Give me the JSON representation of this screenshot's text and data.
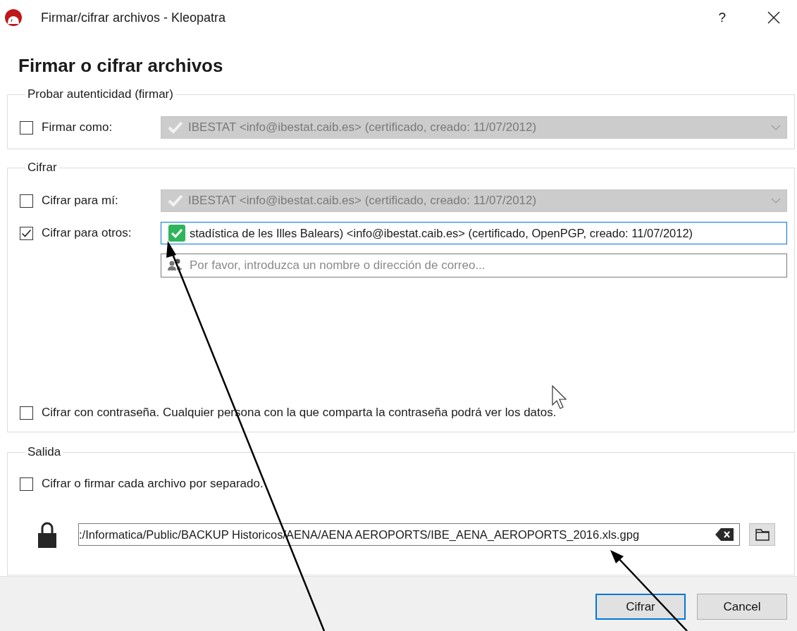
{
  "window": {
    "title": "Firmar/cifrar archivos - Kleopatra",
    "help": "?"
  },
  "heading": "Firmar o cifrar archivos",
  "sign": {
    "legend": "Probar autenticidad (firmar)",
    "sign_as": {
      "label": "Firmar como:",
      "checked": false,
      "value": "IBESTAT <info@ibestat.caib.es> (certificado,  creado: 11/07/2012)",
      "disabled": true
    }
  },
  "encrypt": {
    "legend": "Cifrar",
    "for_me": {
      "label": "Cifrar para mí:",
      "checked": false,
      "value": "IBESTAT <info@ibestat.caib.es> (certificado,  creado: 11/07/2012)",
      "disabled": true
    },
    "for_others": {
      "label": "Cifrar para otros:",
      "checked": true,
      "focused": true,
      "recipients": [
        {
          "value": "stadística de les Illes Balears) <info@ibestat.caib.es> (certificado, OpenPGP, creado: 11/07/2012)",
          "valid": true
        }
      ],
      "placeholder": "Por favor, introduzca un nombre o dirección de correo..."
    },
    "password": {
      "label": "Cifrar con contraseña. Cualquier persona con la que comparta la contraseña podrá ver los datos.",
      "checked": false
    }
  },
  "output": {
    "legend": "Salida",
    "separately": {
      "label": "Cifrar o firmar cada archivo por separado.",
      "checked": false
    },
    "file": {
      "value": ":/Informatica/Public/BACKUP Historicos/AENA/AENA AEROPORTS/IBE_AENA_AEROPORTS_2016.xls.gpg"
    }
  },
  "buttons": [
    {
      "label": "Cifrar",
      "default": true
    },
    {
      "label": "Cancel",
      "default": false
    }
  ]
}
